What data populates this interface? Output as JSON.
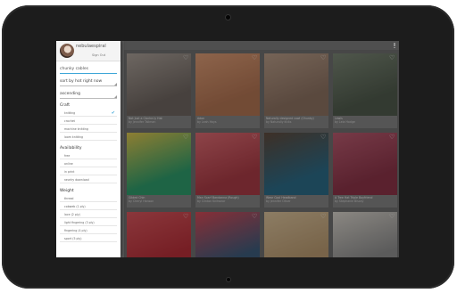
{
  "drawer": {
    "username": "nebulaespiral",
    "sign_out": "Sign Out",
    "search_value": "chunky cables",
    "sort_value": "sort by hot right now",
    "order_value": "ascending",
    "craft_heading": "Craft",
    "craft_options": [
      "knitting",
      "crochet",
      "machine knitting",
      "loom knitting"
    ],
    "craft_selected": "knitting",
    "availability_heading": "Availability",
    "availability_options": [
      "free",
      "online",
      "in print",
      "ravelry download"
    ],
    "weight_heading": "Weight",
    "weight_options": [
      "thread",
      "cobweb (1 ply)",
      "lace (2 ply)",
      "light fingering (3 ply)",
      "fingering (4 ply)",
      "sport (5 ply)"
    ]
  },
  "grid": {
    "tiles": [
      {
        "title": "Not Just a Cloche-ly Hat",
        "by": "by Jennifer Tallman",
        "color1": "#6e6560",
        "color2": "#a89e96"
      },
      {
        "title": "Adon",
        "by": "by Leah Hays",
        "color1": "#b07352",
        "color2": "#d99a74"
      },
      {
        "title": "Naturally designed cowl (Chunky)",
        "by": "by Naturally Knits",
        "color1": "#8a7060",
        "color2": "#b59a86"
      },
      {
        "title": "Lewis",
        "by": "by Lela Hodge",
        "color1": "#4f5a4c",
        "color2": "#7a8574"
      },
      {
        "title": "Gilded Chin",
        "by": "by Cheryl Hanson",
        "color1": "#2e9a6a",
        "color2": "#d9c24e"
      },
      {
        "title": "Man Scarf Bandanna (Rough)",
        "by": "by Clinton Knitwear",
        "color1": "#a83b45",
        "color2": "#d96970"
      },
      {
        "title": "Wear Cool Headband",
        "by": "by Jennifer Oliver",
        "color1": "#2c6a86",
        "color2": "#5f4a3c"
      },
      {
        "title": "A Tree Hat Triple Boyfriend",
        "by": "by Stephanie Biscay",
        "color1": "#8a3448",
        "color2": "#b65a6e"
      },
      {
        "title": "",
        "by": "",
        "color1": "#b52f38",
        "color2": "#d5555c"
      },
      {
        "title": "",
        "by": "",
        "color1": "#3d5b7a",
        "color2": "#d04955"
      },
      {
        "title": "",
        "by": "",
        "color1": "#b89970",
        "color2": "#d8c09a"
      },
      {
        "title": "",
        "by": "",
        "color1": "#8c8c8c",
        "color2": "#d5d0c8"
      }
    ]
  }
}
